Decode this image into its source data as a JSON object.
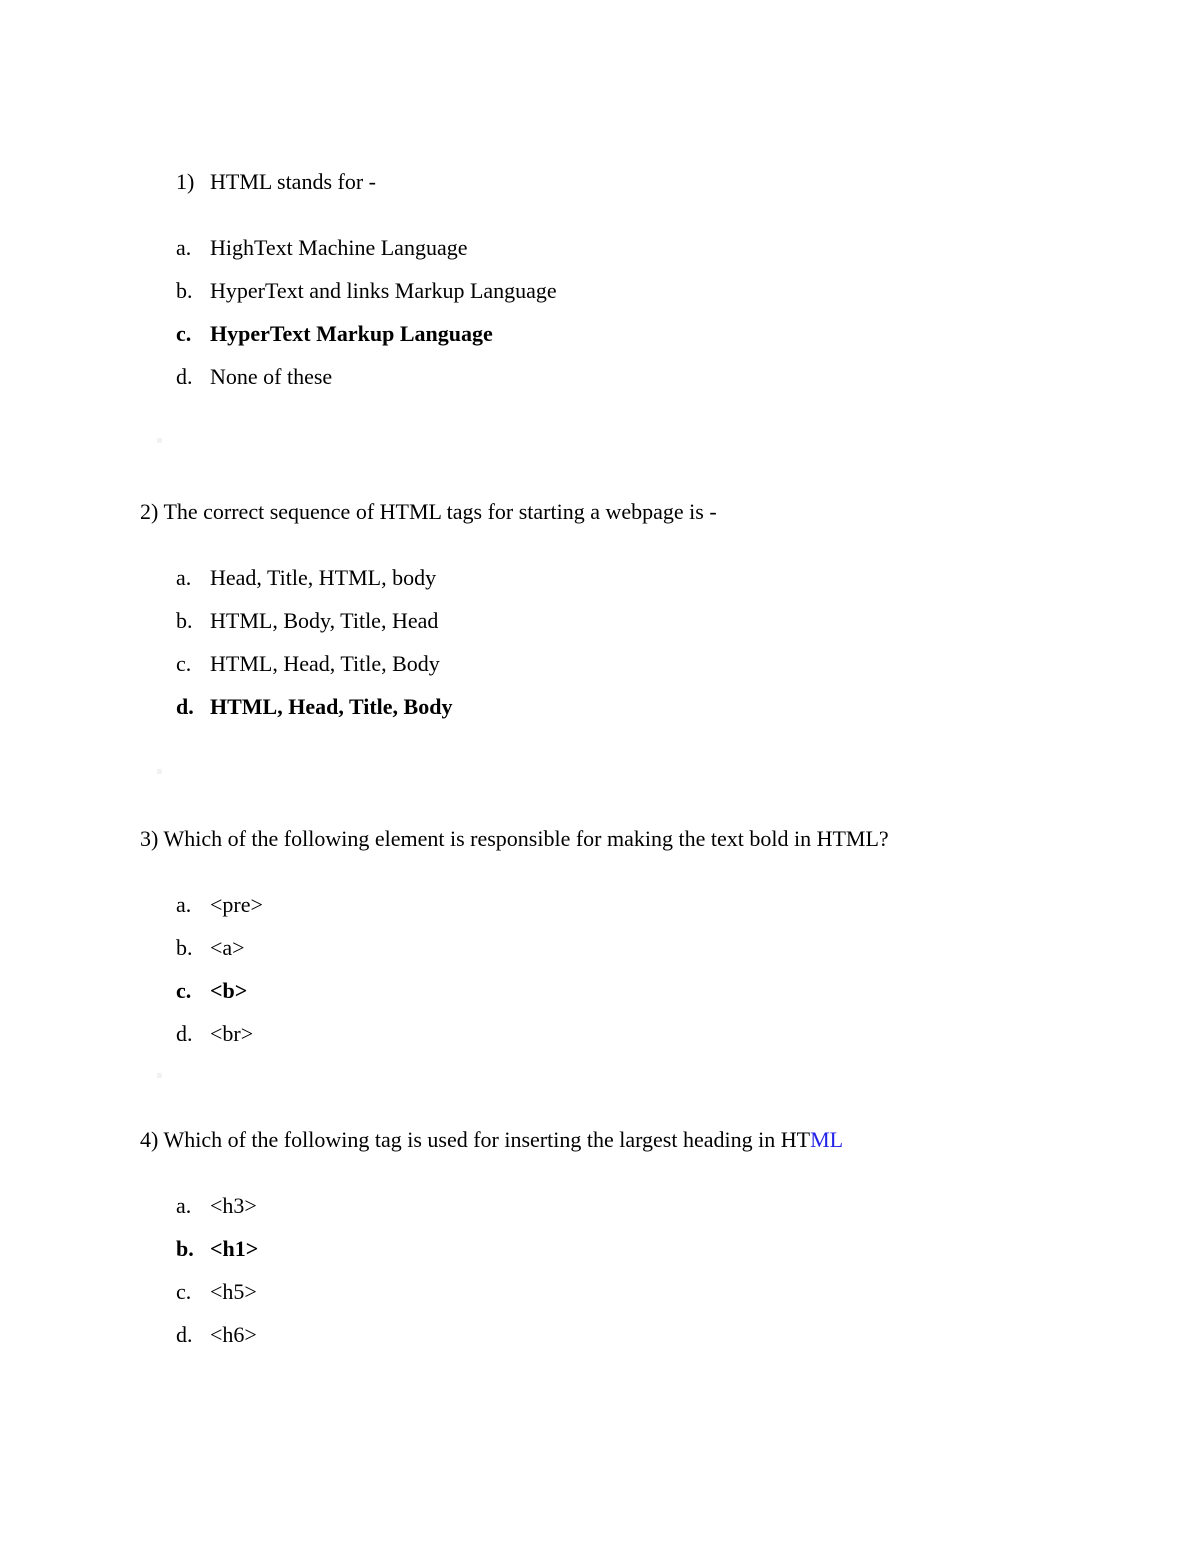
{
  "document": {
    "background_color": "#ffffff",
    "text_color": "#000000",
    "accent_color": "#2222e8"
  },
  "questions": [
    {
      "number_label": "1)",
      "prompt": "HTML stands for -",
      "prompt_blue_suffix": "",
      "layout": "indented",
      "options": [
        {
          "marker": "a.",
          "text": "HighText Machine Language",
          "correct": false
        },
        {
          "marker": "b.",
          "text": "HyperText and links Markup Language",
          "correct": false
        },
        {
          "marker": "c.",
          "text": "HyperText Markup Language",
          "correct": true
        },
        {
          "marker": "d.",
          "text": "None of these",
          "correct": false
        }
      ]
    },
    {
      "number_label": "2)",
      "prompt": "The correct sequence of HTML tags for starting a webpage is -",
      "prompt_blue_suffix": "",
      "layout": "flush",
      "options": [
        {
          "marker": "a.",
          "text": "Head, Title, HTML, body",
          "correct": false
        },
        {
          "marker": "b.",
          "text": "HTML, Body, Title, Head",
          "correct": false
        },
        {
          "marker": "c.",
          "text": "HTML, Head, Title, Body",
          "correct": false
        },
        {
          "marker": "d.",
          "text": "HTML, Head, Title, Body",
          "correct": true
        }
      ]
    },
    {
      "number_label": "3)",
      "prompt": "Which of the following element is responsible for making the text bold in HTML?",
      "prompt_blue_suffix": "",
      "layout": "flush",
      "options": [
        {
          "marker": "a.",
          "text": "<pre>",
          "correct": false
        },
        {
          "marker": "b.",
          "text": "<a>",
          "correct": false
        },
        {
          "marker": "c.",
          "text": "<b>",
          "correct": true
        },
        {
          "marker": "d.",
          "text": "<br>",
          "correct": false
        }
      ]
    },
    {
      "number_label": "4)",
      "prompt": "Which of the following tag is used for inserting the largest heading in HT",
      "prompt_blue_suffix": "ML",
      "layout": "flush",
      "options": [
        {
          "marker": "a.",
          "text": "<h3>",
          "correct": false
        },
        {
          "marker": "b.",
          "text": "<h1>",
          "correct": true
        },
        {
          "marker": "c.",
          "text": "<h5>",
          "correct": false
        },
        {
          "marker": "d.",
          "text": "<h6>",
          "correct": false
        }
      ]
    }
  ]
}
